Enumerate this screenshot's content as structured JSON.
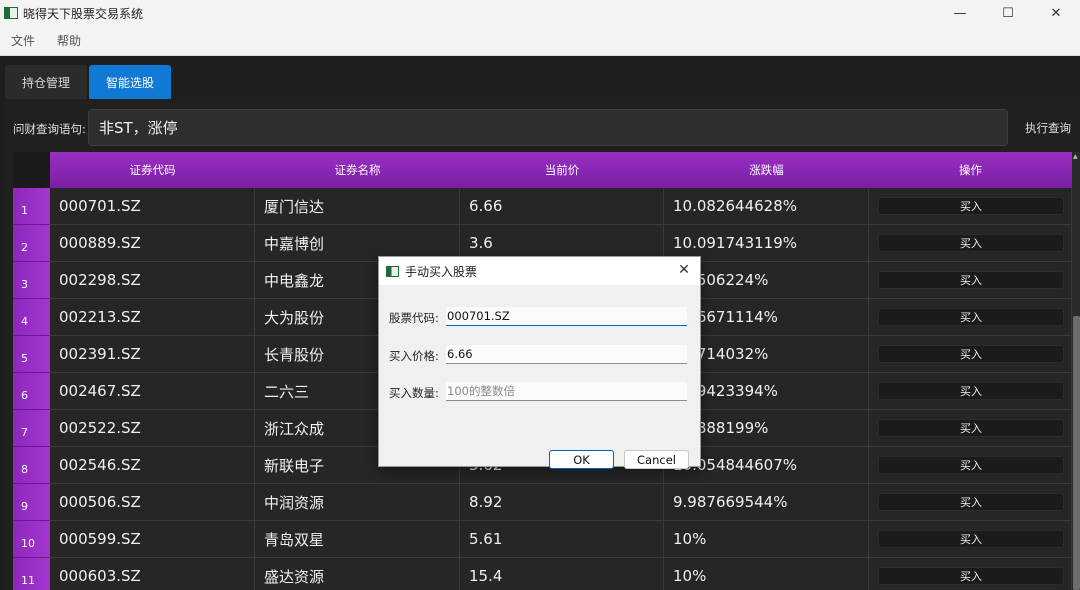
{
  "window": {
    "title": "晓得天下股票交易系统",
    "icon": "app-icon",
    "controls": [
      "minimize-icon",
      "maximize-icon",
      "close-icon"
    ]
  },
  "menu": {
    "items": [
      {
        "label": "文件"
      },
      {
        "label": "帮助"
      }
    ]
  },
  "tabs": [
    {
      "label": "持仓管理",
      "active": false
    },
    {
      "label": "智能选股",
      "active": true
    }
  ],
  "query": {
    "label": "问财查询语句:",
    "value": "非ST，涨停",
    "button_label": "执行查询"
  },
  "table": {
    "headers": [
      "证券代码",
      "证券名称",
      "当前价",
      "涨跌幅",
      "操作"
    ],
    "rows": [
      {
        "num": "1",
        "code": "000701.SZ",
        "name": "厦门信达",
        "price": "6.66",
        "change": "10.082644628%",
        "action": "买入"
      },
      {
        "num": "2",
        "code": "000889.SZ",
        "name": "中嘉博创",
        "price": "3.6",
        "change": "10.091743119%",
        "action": "买入"
      },
      {
        "num": "3",
        "code": "002298.SZ",
        "name": "中电鑫龙",
        "price": "",
        "change": "...8506224%",
        "action": "买入"
      },
      {
        "num": "4",
        "code": "002213.SZ",
        "name": "大为股份",
        "price": "",
        "change": "...06671114%",
        "action": "买入"
      },
      {
        "num": "5",
        "code": "002391.SZ",
        "name": "长青股份",
        "price": "",
        "change": "...6714032%",
        "action": "买入"
      },
      {
        "num": "6",
        "code": "002467.SZ",
        "name": "二六三",
        "price": "",
        "change": "...49423394%",
        "action": "买入"
      },
      {
        "num": "7",
        "code": "002522.SZ",
        "name": "浙江众成",
        "price": "",
        "change": "...7888199%",
        "action": "买入"
      },
      {
        "num": "8",
        "code": "002546.SZ",
        "name": "新联电子",
        "price": "3.62",
        "change": "10.054844607%",
        "action": "买入"
      },
      {
        "num": "9",
        "code": "000506.SZ",
        "name": "中润资源",
        "price": "8.92",
        "change": "9.987669544%",
        "action": "买入"
      },
      {
        "num": "10",
        "code": "000599.SZ",
        "name": "青岛双星",
        "price": "5.61",
        "change": "10%",
        "action": "买入"
      },
      {
        "num": "11",
        "code": "000603.SZ",
        "name": "盛达资源",
        "price": "15.4",
        "change": "10%",
        "action": "买入"
      }
    ]
  },
  "dialog": {
    "title": "手动买入股票",
    "icon": "app-icon",
    "fields": [
      {
        "label": "股票代码:",
        "value": "000701.SZ",
        "placeholder": ""
      },
      {
        "label": "买入价格:",
        "value": "6.66",
        "placeholder": ""
      },
      {
        "label": "买入数量:",
        "value": "",
        "placeholder": "100的整数倍"
      }
    ],
    "ok_label": "OK",
    "cancel_label": "Cancel"
  },
  "colors": {
    "accent": "#0f7ad6",
    "header_purple": "#8e27bd",
    "background": "#1e1e1e"
  }
}
